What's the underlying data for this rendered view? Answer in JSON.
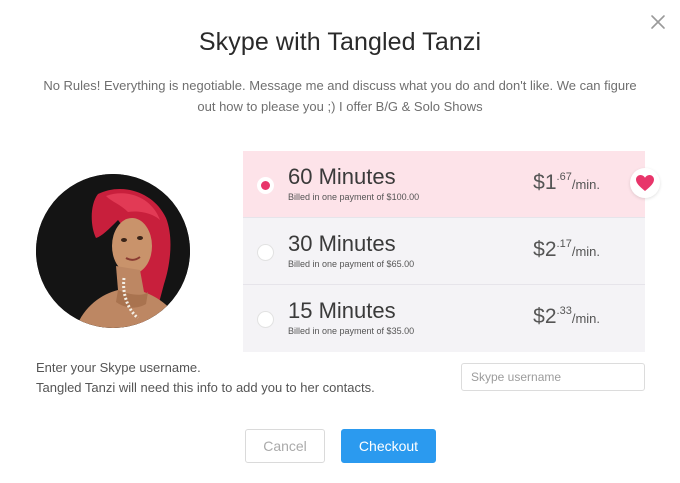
{
  "dialog": {
    "title": "Skype with Tangled Tanzi",
    "description": "No Rules! Everything is negotiable. Message me and discuss what you do and don't like. We can figure out how to please you ;) I offer B/G & Solo Shows"
  },
  "options": [
    {
      "title": "60 Minutes",
      "billing": "Billed in one payment of $100.00",
      "price_dollar": "$1",
      "price_cents": ".67",
      "price_unit": "/min.",
      "selected": true
    },
    {
      "title": "30 Minutes",
      "billing": "Billed in one payment of $65.00",
      "price_dollar": "$2",
      "price_cents": ".17",
      "price_unit": "/min.",
      "selected": false
    },
    {
      "title": "15 Minutes",
      "billing": "Billed in one payment of $35.00",
      "price_dollar": "$2",
      "price_cents": ".33",
      "price_unit": "/min.",
      "selected": false
    }
  ],
  "skype": {
    "instruction_line1": "Enter your Skype username.",
    "instruction_line2": "Tangled Tanzi will need this info to add you to her contacts.",
    "placeholder": "Skype username",
    "value": ""
  },
  "buttons": {
    "cancel": "Cancel",
    "checkout": "Checkout"
  },
  "icons": {
    "close": "close-icon",
    "favorite": "heart-icon",
    "avatar": "profile-photo"
  },
  "colors": {
    "accent": "#e8356a",
    "selected_bg": "#fde3e9",
    "option_bg": "#f4f3f6",
    "primary_button": "#2b9aef"
  }
}
